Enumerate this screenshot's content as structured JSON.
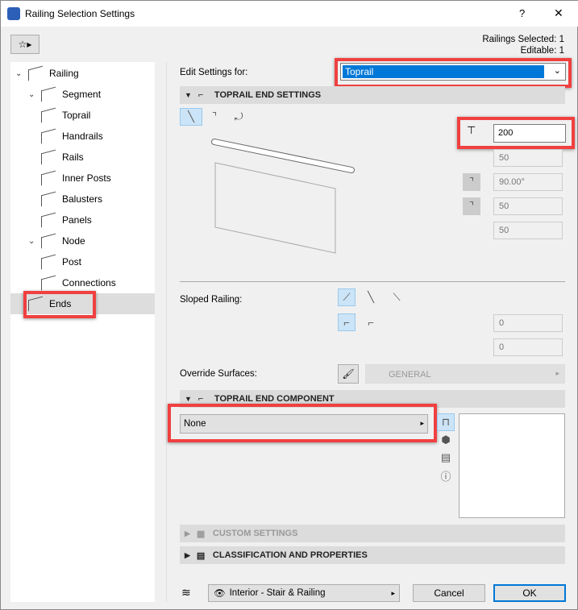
{
  "window": {
    "title": "Railing Selection Settings",
    "help": "?",
    "close": "✕"
  },
  "status": {
    "selected": "Railings Selected: 1",
    "editable": "Editable: 1"
  },
  "tree": [
    {
      "label": "Railing",
      "level": 0,
      "chev": "⌄"
    },
    {
      "label": "Segment",
      "level": 1,
      "chev": "⌄"
    },
    {
      "label": "Toprail",
      "level": 2
    },
    {
      "label": "Handrails",
      "level": 2
    },
    {
      "label": "Rails",
      "level": 2
    },
    {
      "label": "Inner Posts",
      "level": 2
    },
    {
      "label": "Balusters",
      "level": 2
    },
    {
      "label": "Panels",
      "level": 2
    },
    {
      "label": "Node",
      "level": 1,
      "chev": "⌄"
    },
    {
      "label": "Post",
      "level": 2
    },
    {
      "label": "Connections",
      "level": 2
    },
    {
      "label": "Ends",
      "level": 1,
      "selected": true
    }
  ],
  "edit_settings": {
    "label": "Edit Settings for:",
    "value": "Toprail"
  },
  "sections": {
    "toprail_end": "TOPRAIL END SETTINGS",
    "component": "TOPRAIL END COMPONENT",
    "custom": "CUSTOM SETTINGS",
    "classification": "CLASSIFICATION AND PROPERTIES"
  },
  "fields": {
    "length": "200",
    "radius": "50",
    "angle": "90.00°",
    "height": "50",
    "offset": "50",
    "slope1": "0",
    "slope2": "0"
  },
  "sloped_label": "Sloped Railing:",
  "override": {
    "label": "Override Surfaces:",
    "value": "GENERAL"
  },
  "component_value": "None",
  "footer": {
    "view": "Interior - Stair & Railing",
    "cancel": "Cancel",
    "ok": "OK"
  },
  "colors": {
    "accent": "#0078d7",
    "highlight": "#f04040"
  }
}
